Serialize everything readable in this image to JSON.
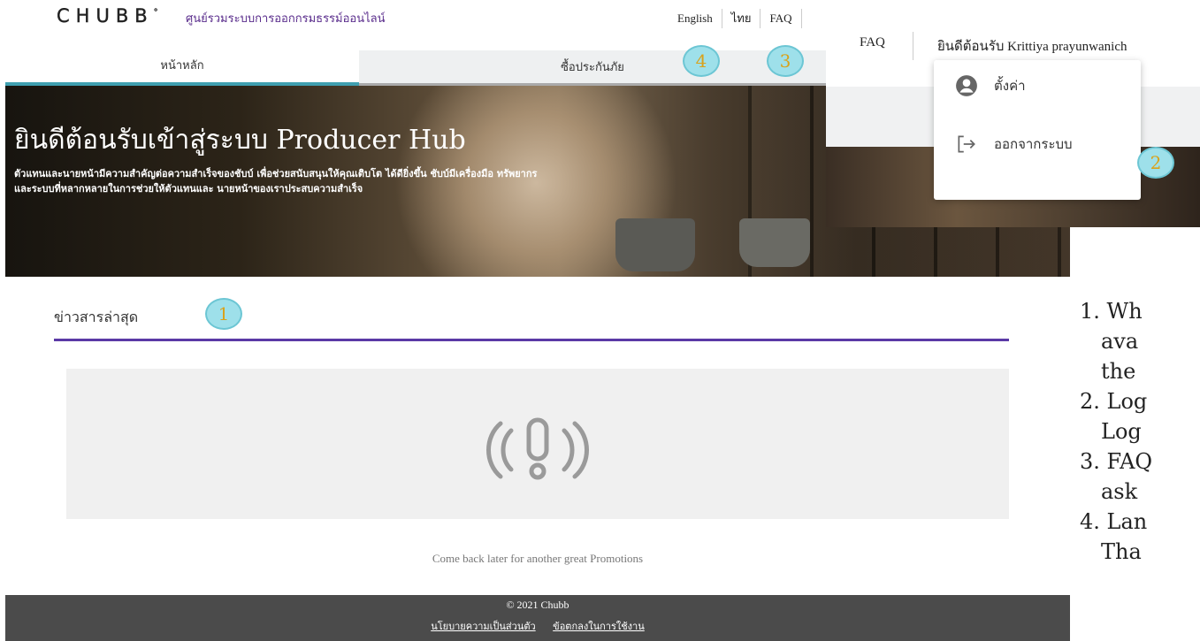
{
  "header": {
    "logo": "CHUBB",
    "logo_mark": "°",
    "subtitle": "ศูนย์รวมระบบการออกกรมธรรม์ออนไลน์",
    "links": [
      "English",
      "ไทย",
      "FAQ"
    ]
  },
  "nav": {
    "tabs": [
      {
        "label": "หน้าหลัก"
      },
      {
        "label": "ซื้อประกันภัย"
      }
    ]
  },
  "hero": {
    "title": "ยินดีต้อนรับเข้าสู่ระบบ Producer Hub",
    "desc": "ตัวแทนและนายหน้ามีความสำคัญต่อความสำเร็จของชับบ์ เพื่อช่วยสนับสนุนให้คุณเติบโต ได้ดียิ่งขึ้น ชับบ์มีเครื่องมือ ทรัพยากร และระบบที่หลากหลายในการช่วยให้ตัวแทนและ นายหน้าของเราประสบความสำเร็จ"
  },
  "news": {
    "title": "ข่าวสารล่าสุด",
    "empty_message": "Come back later for another great Promotions",
    "empty_icon": "alert-icon"
  },
  "footer": {
    "copyright": "© 2021 Chubb",
    "links": [
      "นโยบายความเป็นส่วนตัว",
      "ข้อตกลงในการใช้งาน"
    ]
  },
  "zoom": {
    "faq": "FAQ",
    "welcome": "ยินดีต้อนรับ Krittiya prayunwanich",
    "menu": [
      {
        "label": "ตั้งค่า",
        "icon": "account-circle-icon"
      },
      {
        "label": "ออกจากระบบ",
        "icon": "logout-icon"
      }
    ]
  },
  "badges": [
    "1",
    "2",
    "3",
    "4"
  ],
  "legend": [
    "1. Wh",
    "ava",
    "the",
    "2. Log",
    "Log",
    "3. FAQ",
    "ask",
    "4. Lan",
    "Tha"
  ],
  "colors": {
    "accent_teal": "#3f9fb0",
    "accent_purple": "#5b3aa6",
    "badge_fill": "#9ee0ea",
    "badge_text": "#d9a21b"
  }
}
